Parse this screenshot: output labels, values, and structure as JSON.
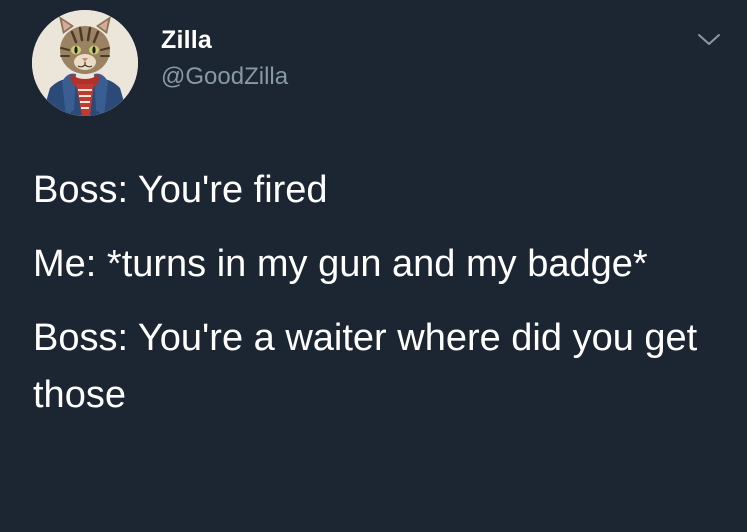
{
  "user": {
    "display_name": "Zilla",
    "handle": "@GoodZilla",
    "avatar_icon": "cat-avatar-icon"
  },
  "menu": {
    "icon": "chevron-down-icon"
  },
  "tweet": {
    "lines": [
      "Boss: You're fired",
      "Me: *turns in my gun and my badge*",
      "Boss: You're a waiter where did you get those"
    ]
  },
  "colors": {
    "background": "#1c2532",
    "text": "#ffffff",
    "secondary_text": "#8899a6"
  }
}
